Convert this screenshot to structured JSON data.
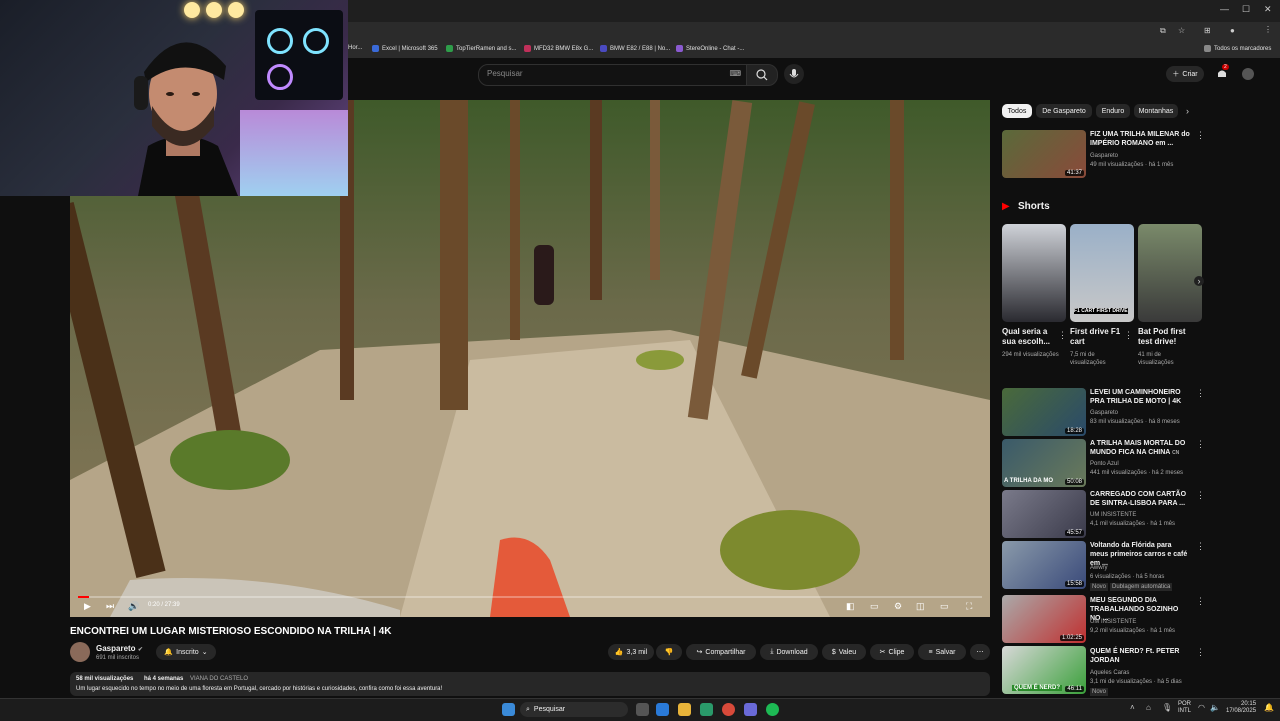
{
  "browser": {
    "bookmarks": [
      "Hor...",
      "Excel | Microsoft 365",
      "TopTierRamen and s...",
      "MFD32 BMW E8x G...",
      "BMW E82 / E88 | No...",
      "StereOnline - Chat -..."
    ],
    "all_bookmarks_label": "Todos os marcadores"
  },
  "header": {
    "search_placeholder": "Pesquisar",
    "create_label": "Criar",
    "notification_count": "2"
  },
  "player": {
    "time": "0:20 / 27:39",
    "progress": 0.012
  },
  "video": {
    "title": "ENCONTREI UM LUGAR MISTERIOSO ESCONDIDO NA TRILHA | 4K",
    "channel": "Gaspareto",
    "subscribers": "691 mil inscritos",
    "subscribed_label": "Inscrito",
    "likes": "3,3 mil",
    "share_label": "Compartilhar",
    "download_label": "Download",
    "thanks_label": "Valeu",
    "clip_label": "Clipe",
    "save_label": "Salvar",
    "views": "58 mil visualizações",
    "date": "há 4 semanas",
    "location": "VIANA DO CASTELO",
    "description": "Um lugar esquecido no tempo no meio de uma floresta em Portugal, cercado por histórias e curiosidades, confira como foi essa aventura!"
  },
  "sidebar": {
    "chips": [
      "Todos",
      "De Gaspareto",
      "Enduro",
      "Montanhas"
    ],
    "first": {
      "title": "FIZ UMA TRILHA MILENAR do IMPÉRIO ROMANO em ...",
      "channel": "Gaspareto",
      "meta": "49 mil visualizações · há 1 mês",
      "duration": "41:37"
    },
    "shorts_label": "Shorts",
    "shorts": [
      {
        "title": "Qual seria a sua escolh...",
        "views": "294 mil visualizações"
      },
      {
        "title": "First drive F1 cart",
        "views": "7,5 mi de visualizações",
        "overlay": "F1 CART FIRST DRIVE"
      },
      {
        "title": "Bat Pod first test drive!",
        "views": "41 mi de visualizações"
      }
    ],
    "videos": [
      {
        "title": "LEVEI UM CAMINHONEIRO PRA TRILHA DE MOTO | 4K",
        "channel": "Gaspareto",
        "meta": "83 mil visualizações · há 8 meses",
        "duration": "18:28"
      },
      {
        "title": "A TRILHA MAIS MORTAL DO MUNDO FICA NA CHINA",
        "cn": "CN",
        "channel": "Ponto Azul",
        "meta": "441 mil visualizações · há 2 meses",
        "duration": "50:08",
        "overlay": "A TRILHA DA MO"
      },
      {
        "title": "CARREGADO COM CARTÃO DE SINTRA-LISBOA PARA ...",
        "channel": "UM INSISTENTE",
        "meta": "4,1 mil visualizações · há 1 mês",
        "duration": "45:57"
      },
      {
        "title": "Voltando da Flórida para meus primeiros carros e café em ...",
        "channel": "Awwry",
        "meta": "6 visualizações · há 5 horas",
        "badge1": "Novo",
        "badge2": "Dublagem automática",
        "duration": "15:58"
      },
      {
        "title": "MEU SEGUNDO DIA TRABALHANDO SOZINHO NO ...",
        "channel": "UM INSISTENTE",
        "meta": "9,2 mil visualizações · há 1 mês",
        "duration": "1:02:25"
      },
      {
        "title": "QUEM É NERD? Ft. PETER JORDAN",
        "channel": "Aqueles Caras",
        "meta": "3,1 mi de visualizações · há 5 dias",
        "badge1": "Novo",
        "duration": "46:11",
        "overlay": "QUEM É NERD?"
      }
    ]
  },
  "taskbar": {
    "search_label": "Pesquisar",
    "lang1": "POR",
    "lang2": "INTL",
    "time": "20:15",
    "date": "17/08/2025"
  }
}
